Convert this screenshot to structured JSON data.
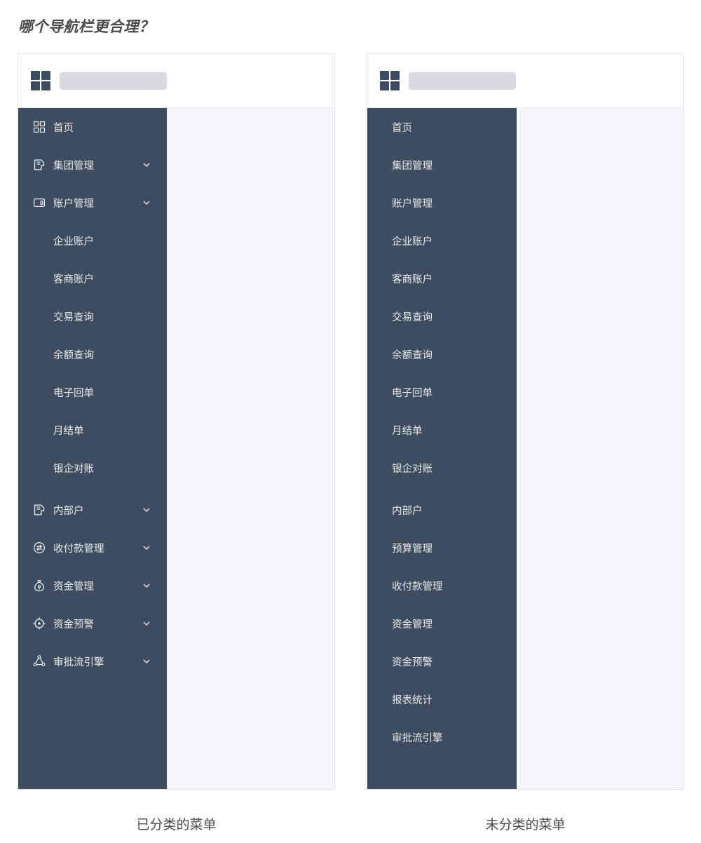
{
  "title": "哪个导航栏更合理？",
  "colors": {
    "sidebar_bg": "#3e4c5f",
    "content_bg": "#f5f7fa",
    "logo": "#3c4b5f",
    "placeholder": "#d8dade",
    "nav_text": "#e8eaee",
    "title_text": "#4a4a4a"
  },
  "panels": [
    {
      "id": "categorized",
      "caption": "已分类的菜单",
      "header": {
        "logo_icon": "grid-2x2-icon",
        "placeholder_label": ""
      },
      "nav_items": [
        {
          "label": "首页",
          "level": "parent",
          "icon": "grid-2x2-icon",
          "chevron": false,
          "gap_before": false
        },
        {
          "label": "集团管理",
          "level": "parent",
          "icon": "document-icon",
          "chevron": true,
          "gap_before": false
        },
        {
          "label": "账户管理",
          "level": "parent",
          "icon": "wallet-icon",
          "chevron": true,
          "gap_before": false
        },
        {
          "label": "企业账户",
          "level": "child",
          "icon": "",
          "chevron": false,
          "gap_before": false
        },
        {
          "label": "客商账户",
          "level": "child",
          "icon": "",
          "chevron": false,
          "gap_before": false
        },
        {
          "label": "交易查询",
          "level": "child",
          "icon": "",
          "chevron": false,
          "gap_before": false
        },
        {
          "label": "余额查询",
          "level": "child",
          "icon": "",
          "chevron": false,
          "gap_before": false
        },
        {
          "label": "电子回单",
          "level": "child",
          "icon": "",
          "chevron": false,
          "gap_before": false
        },
        {
          "label": "月结单",
          "level": "child",
          "icon": "",
          "chevron": false,
          "gap_before": false
        },
        {
          "label": "银企对账",
          "level": "child",
          "icon": "",
          "chevron": false,
          "gap_before": false
        },
        {
          "label": "内部户",
          "level": "parent",
          "icon": "document-icon",
          "chevron": true,
          "gap_before": true
        },
        {
          "label": "收付款管理",
          "level": "parent",
          "icon": "exchange-icon",
          "chevron": true,
          "gap_before": false
        },
        {
          "label": "资金管理",
          "level": "parent",
          "icon": "money-bag-icon",
          "chevron": true,
          "gap_before": false
        },
        {
          "label": "资金预警",
          "level": "parent",
          "icon": "target-icon",
          "chevron": true,
          "gap_before": false
        },
        {
          "label": "审批流引擎",
          "level": "parent",
          "icon": "flow-node-icon",
          "chevron": true,
          "gap_before": false
        }
      ]
    },
    {
      "id": "uncategorized",
      "caption": "未分类的菜单",
      "header": {
        "logo_icon": "grid-2x2-icon",
        "placeholder_label": ""
      },
      "nav_items": [
        {
          "label": "首页",
          "level": "flat",
          "icon": "",
          "chevron": false,
          "gap_before": false
        },
        {
          "label": "集团管理",
          "level": "flat",
          "icon": "",
          "chevron": false,
          "gap_before": false
        },
        {
          "label": "账户管理",
          "level": "flat",
          "icon": "",
          "chevron": false,
          "gap_before": false
        },
        {
          "label": "企业账户",
          "level": "flat",
          "icon": "",
          "chevron": false,
          "gap_before": false
        },
        {
          "label": "客商账户",
          "level": "flat",
          "icon": "",
          "chevron": false,
          "gap_before": false
        },
        {
          "label": "交易查询",
          "level": "flat",
          "icon": "",
          "chevron": false,
          "gap_before": false
        },
        {
          "label": "余额查询",
          "level": "flat",
          "icon": "",
          "chevron": false,
          "gap_before": false
        },
        {
          "label": "电子回单",
          "level": "flat",
          "icon": "",
          "chevron": false,
          "gap_before": false
        },
        {
          "label": "月结单",
          "level": "flat",
          "icon": "",
          "chevron": false,
          "gap_before": false
        },
        {
          "label": "银企对账",
          "level": "flat",
          "icon": "",
          "chevron": false,
          "gap_before": false
        },
        {
          "label": "内部户",
          "level": "flat",
          "icon": "",
          "chevron": false,
          "gap_before": true
        },
        {
          "label": "预算管理",
          "level": "flat",
          "icon": "",
          "chevron": false,
          "gap_before": false
        },
        {
          "label": "收付款管理",
          "level": "flat",
          "icon": "",
          "chevron": false,
          "gap_before": false
        },
        {
          "label": "资金管理",
          "level": "flat",
          "icon": "",
          "chevron": false,
          "gap_before": false
        },
        {
          "label": "资金预警",
          "level": "flat",
          "icon": "",
          "chevron": false,
          "gap_before": false
        },
        {
          "label": "报表统计",
          "level": "flat",
          "icon": "",
          "chevron": false,
          "gap_before": false
        },
        {
          "label": "审批流引擎",
          "level": "flat",
          "icon": "",
          "chevron": false,
          "gap_before": false
        }
      ]
    }
  ]
}
